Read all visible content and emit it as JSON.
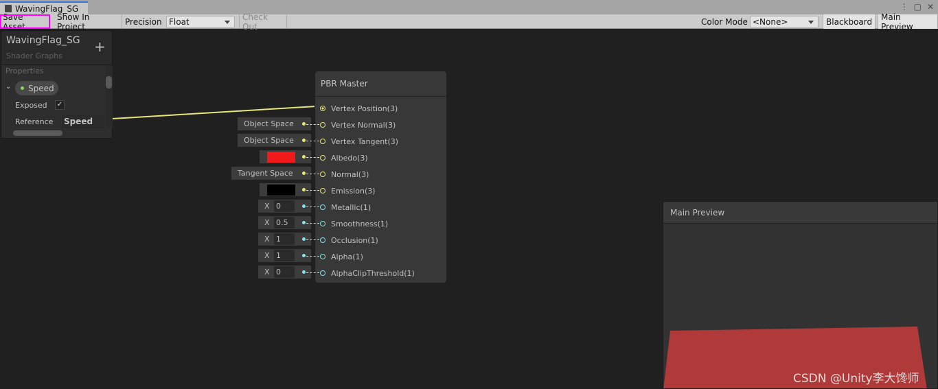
{
  "tab": {
    "title": "WavingFlag_SG"
  },
  "window_controls": {
    "menu": "⋮",
    "maximize": "▢",
    "close": "✕"
  },
  "toolbar": {
    "save": "Save Asset",
    "show": "Show In Project",
    "precision_label": "Precision",
    "precision_value": "Float",
    "checkout": "Check Out",
    "color_mode_label": "Color Mode",
    "color_mode_value": "<None>",
    "blackboard": "Blackboard",
    "main_preview": "Main Preview"
  },
  "blackboard": {
    "title": "WavingFlag_SG",
    "subtitle": "Shader Graphs",
    "add": "+",
    "section": "Properties",
    "property": {
      "name": "Speed",
      "exposed_label": "Exposed",
      "exposed": true,
      "reference_label": "Reference",
      "reference_value": "Speed"
    }
  },
  "node": {
    "title": "PBR Master",
    "ports": [
      {
        "label": "Vertex Position(3)",
        "type": "vec3",
        "connected": true
      },
      {
        "label": "Vertex Normal(3)",
        "type": "vec3",
        "input": {
          "kind": "space",
          "value": "Object Space"
        }
      },
      {
        "label": "Vertex Tangent(3)",
        "type": "vec3",
        "input": {
          "kind": "space",
          "value": "Object Space"
        }
      },
      {
        "label": "Albedo(3)",
        "type": "vec3",
        "input": {
          "kind": "color",
          "value": "#f01a1a"
        }
      },
      {
        "label": "Normal(3)",
        "type": "vec3",
        "input": {
          "kind": "space",
          "value": "Tangent Space"
        }
      },
      {
        "label": "Emission(3)",
        "type": "vec3",
        "input": {
          "kind": "color",
          "value": "#000000"
        }
      },
      {
        "label": "Metallic(1)",
        "type": "float",
        "input": {
          "kind": "float",
          "axis": "X",
          "value": "0"
        }
      },
      {
        "label": "Smoothness(1)",
        "type": "float",
        "input": {
          "kind": "float",
          "axis": "X",
          "value": "0.5"
        }
      },
      {
        "label": "Occlusion(1)",
        "type": "float",
        "input": {
          "kind": "float",
          "axis": "X",
          "value": "1"
        }
      },
      {
        "label": "Alpha(1)",
        "type": "float",
        "input": {
          "kind": "float",
          "axis": "X",
          "value": "1"
        }
      },
      {
        "label": "AlphaClipThreshold(1)",
        "type": "float",
        "input": {
          "kind": "float",
          "axis": "X",
          "value": "0"
        }
      }
    ]
  },
  "colors": {
    "vec3": "#e6e67a",
    "float": "#84e4e7",
    "highlight": "#ff00ff",
    "flag": "#b03a3a"
  },
  "preview": {
    "title": "Main Preview"
  },
  "watermark": "CSDN @Unity李大馋师"
}
